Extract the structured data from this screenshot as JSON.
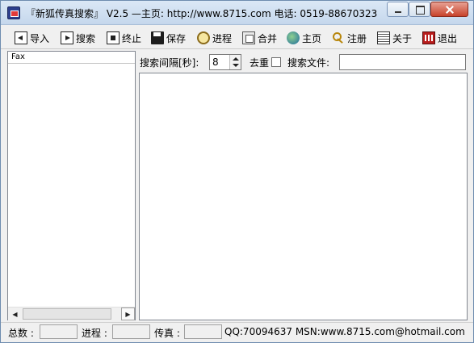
{
  "window": {
    "title": "『新狐传真搜索』 V2.5  —主页: http://www.8715.com 电话: 0519-88670323",
    "accent_color": "#c5d7ec"
  },
  "toolbar": {
    "items": [
      {
        "label": "导入",
        "icon": "import-icon"
      },
      {
        "label": "搜索",
        "icon": "play-icon"
      },
      {
        "label": "终止",
        "icon": "stop-icon"
      },
      {
        "label": "保存",
        "icon": "save-icon"
      },
      {
        "label": "进程",
        "icon": "progress-icon"
      },
      {
        "label": "合并",
        "icon": "merge-icon"
      },
      {
        "label": "主页",
        "icon": "globe-icon"
      },
      {
        "label": "注册",
        "icon": "key-icon"
      },
      {
        "label": "关于",
        "icon": "about-icon"
      },
      {
        "label": "退出",
        "icon": "exit-icon"
      }
    ]
  },
  "list": {
    "header": "Fax"
  },
  "search": {
    "interval_label": "搜索间隔[秒]:",
    "interval_value": "8",
    "dedupe_label": "去重",
    "dedupe_checked": false,
    "file_label": "搜索文件:",
    "file_value": ""
  },
  "status": {
    "total_label": "总数 :",
    "total_value": "",
    "progress_label": "进程 :",
    "progress_value": "",
    "fax_label": "传真 :",
    "fax_value": "",
    "contact": "QQ:70094637 MSN:www.8715.com@hotmail.com"
  }
}
